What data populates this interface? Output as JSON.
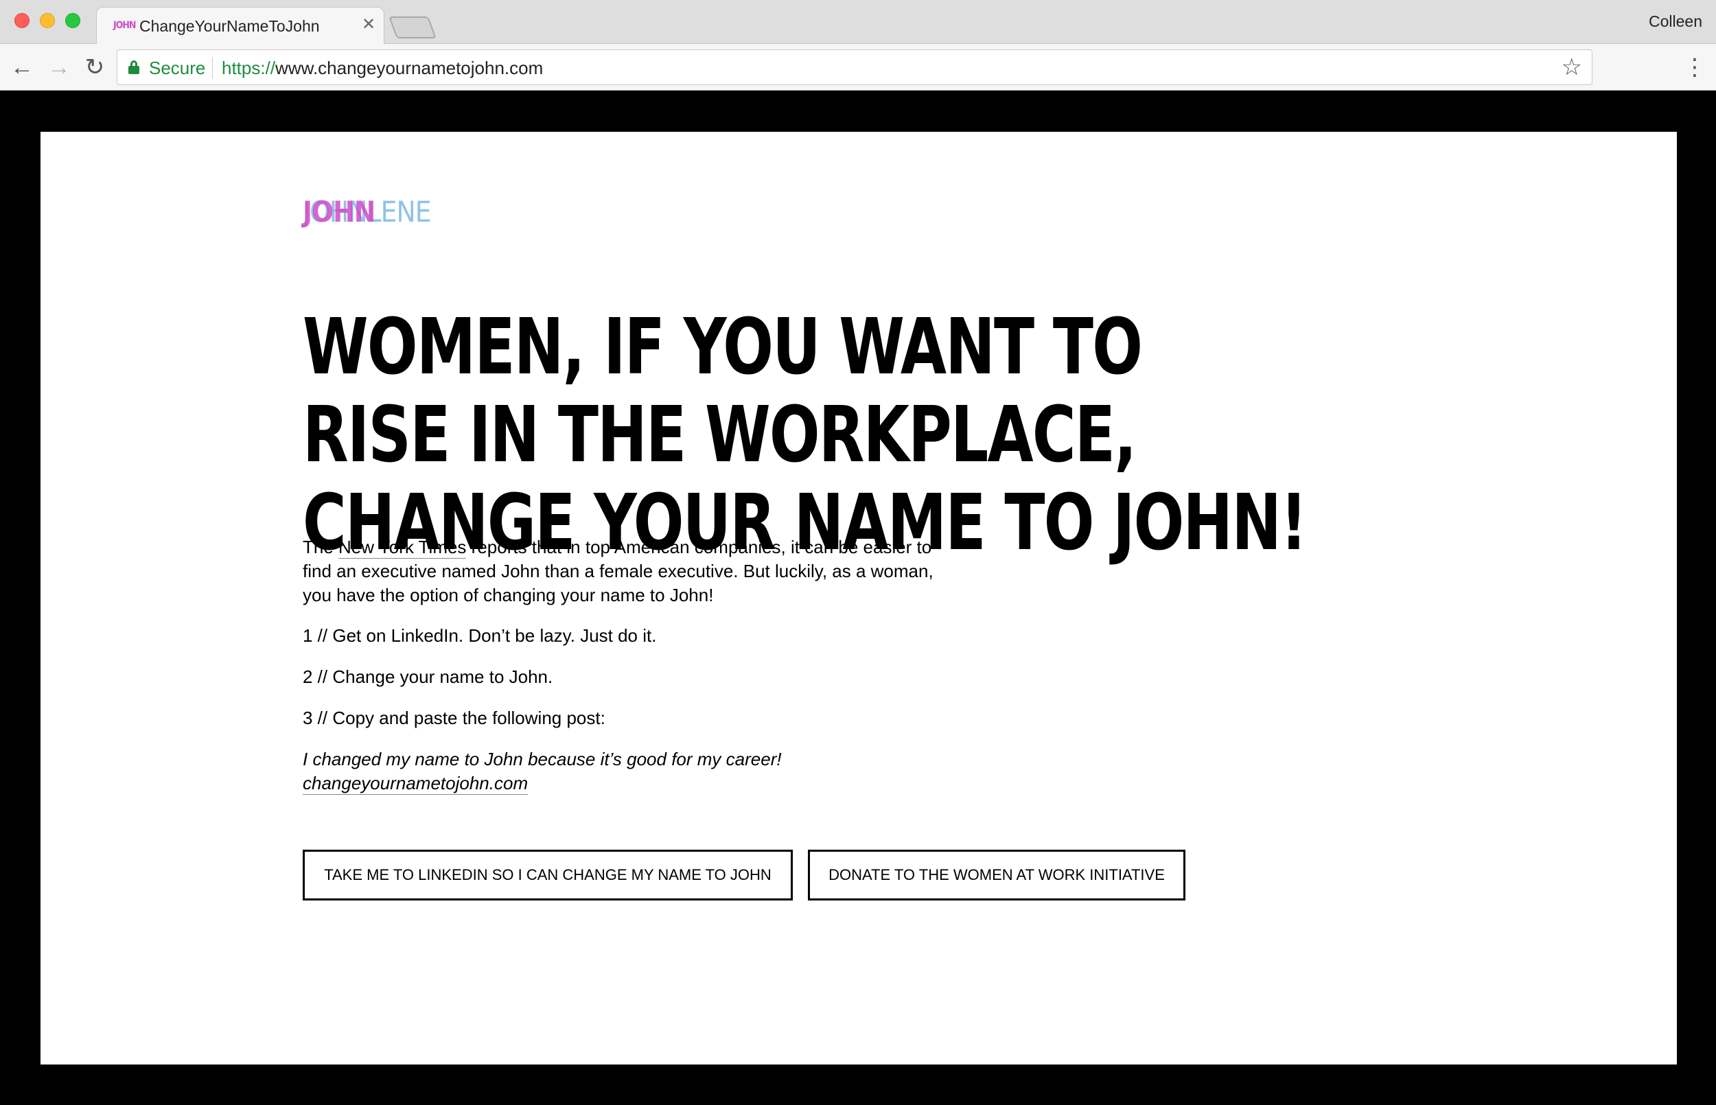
{
  "browser": {
    "tab": {
      "favicon_text": "JOHN",
      "title": "ChangeYourNameToJohn",
      "close_glyph": "✕"
    },
    "profile_name": "Colleen",
    "nav": {
      "back_glyph": "←",
      "forward_glyph": "→",
      "reload_glyph": "↻"
    },
    "omnibox": {
      "secure_label": "Secure",
      "url_scheme": "https://",
      "url_host": "www.changeyournametojohn.com"
    },
    "icons": {
      "star": "☆",
      "menu": "⋮"
    }
  },
  "page": {
    "logo": {
      "overlay": "JOHN",
      "base": "JOHNLENE"
    },
    "headline": "WOMEN, IF YOU WANT TO RISE IN THE WORKPLACE, CHANGE YOUR NAME TO JOHN!",
    "intro": {
      "prefix": "The ",
      "link": "New York Times",
      "suffix": " reports that in top American companies, it can be easier to find an executive named John than a female executive. But luckily, as a woman, you have the option of changing your name to John!"
    },
    "steps": [
      "1 // Get on LinkedIn. Don’t be lazy. Just do it.",
      "2 // Change your name to John.",
      "3 // Copy and paste the following post:"
    ],
    "post": {
      "text": "I changed my name to John because it’s good for my career!",
      "link": "changeyournametojohn.com"
    },
    "buttons": {
      "linkedin": "TAKE ME TO LINKEDIN SO I CAN CHANGE MY NAME TO JOHN",
      "donate": "DONATE TO THE WOMEN AT WORK INITIATIVE"
    }
  },
  "colors": {
    "logo_pink": "#d04cc8",
    "logo_blue": "#8fc3e6",
    "secure_green": "#1f8c3c"
  }
}
